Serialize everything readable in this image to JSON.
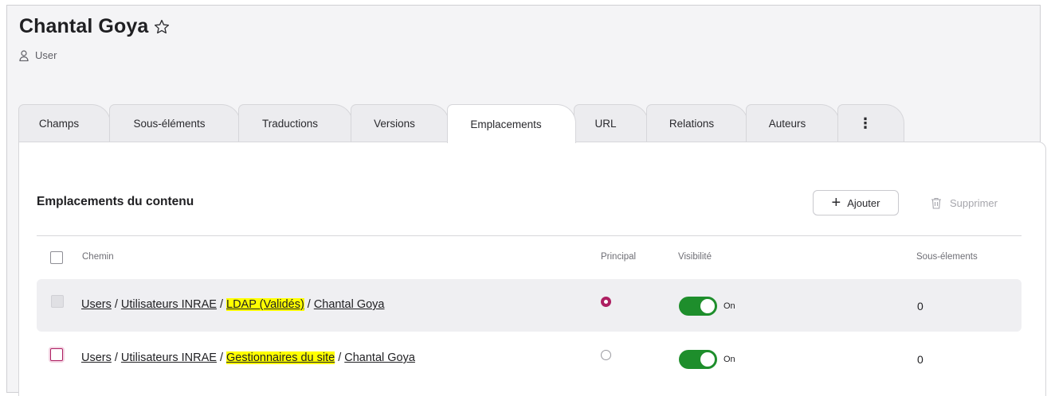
{
  "header": {
    "title": "Chantal Goya",
    "subtitle": "User",
    "star_icon": "star-outline-icon",
    "user_icon": "user-icon"
  },
  "tabs": [
    {
      "label": "Champs"
    },
    {
      "label": "Sous-éléments"
    },
    {
      "label": "Traductions"
    },
    {
      "label": "Versions"
    },
    {
      "label": "Emplacements",
      "active": true
    },
    {
      "label": "URL"
    },
    {
      "label": "Relations"
    },
    {
      "label": "Auteurs"
    },
    {
      "label": "⋮",
      "icon": "more-vertical-icon"
    }
  ],
  "section": {
    "title": "Emplacements du contenu",
    "add_label": "Ajouter",
    "delete_label": "Supprimer"
  },
  "table": {
    "columns": {
      "path": "Chemin",
      "main": "Principal",
      "visibility": "Visibilité",
      "subitems": "Sous-élements"
    },
    "rows": [
      {
        "segments": [
          "Users",
          "Utilisateurs INRAE",
          "LDAP (Validés)",
          "Chantal Goya"
        ],
        "highlighted_segment": "LDAP (Validés)",
        "principal": true,
        "visibility": "On",
        "subitems": "0"
      },
      {
        "segments": [
          "Users",
          "Utilisateurs INRAE",
          "Gestionnaires du site",
          "Chantal Goya"
        ],
        "highlighted_segment": "Gestionnaires du site",
        "principal": false,
        "visibility": "On",
        "subitems": "0"
      }
    ]
  },
  "colors": {
    "accent": "#ad1f62",
    "toggle_on": "#1e8e2c",
    "highlight": "#ffff00"
  }
}
